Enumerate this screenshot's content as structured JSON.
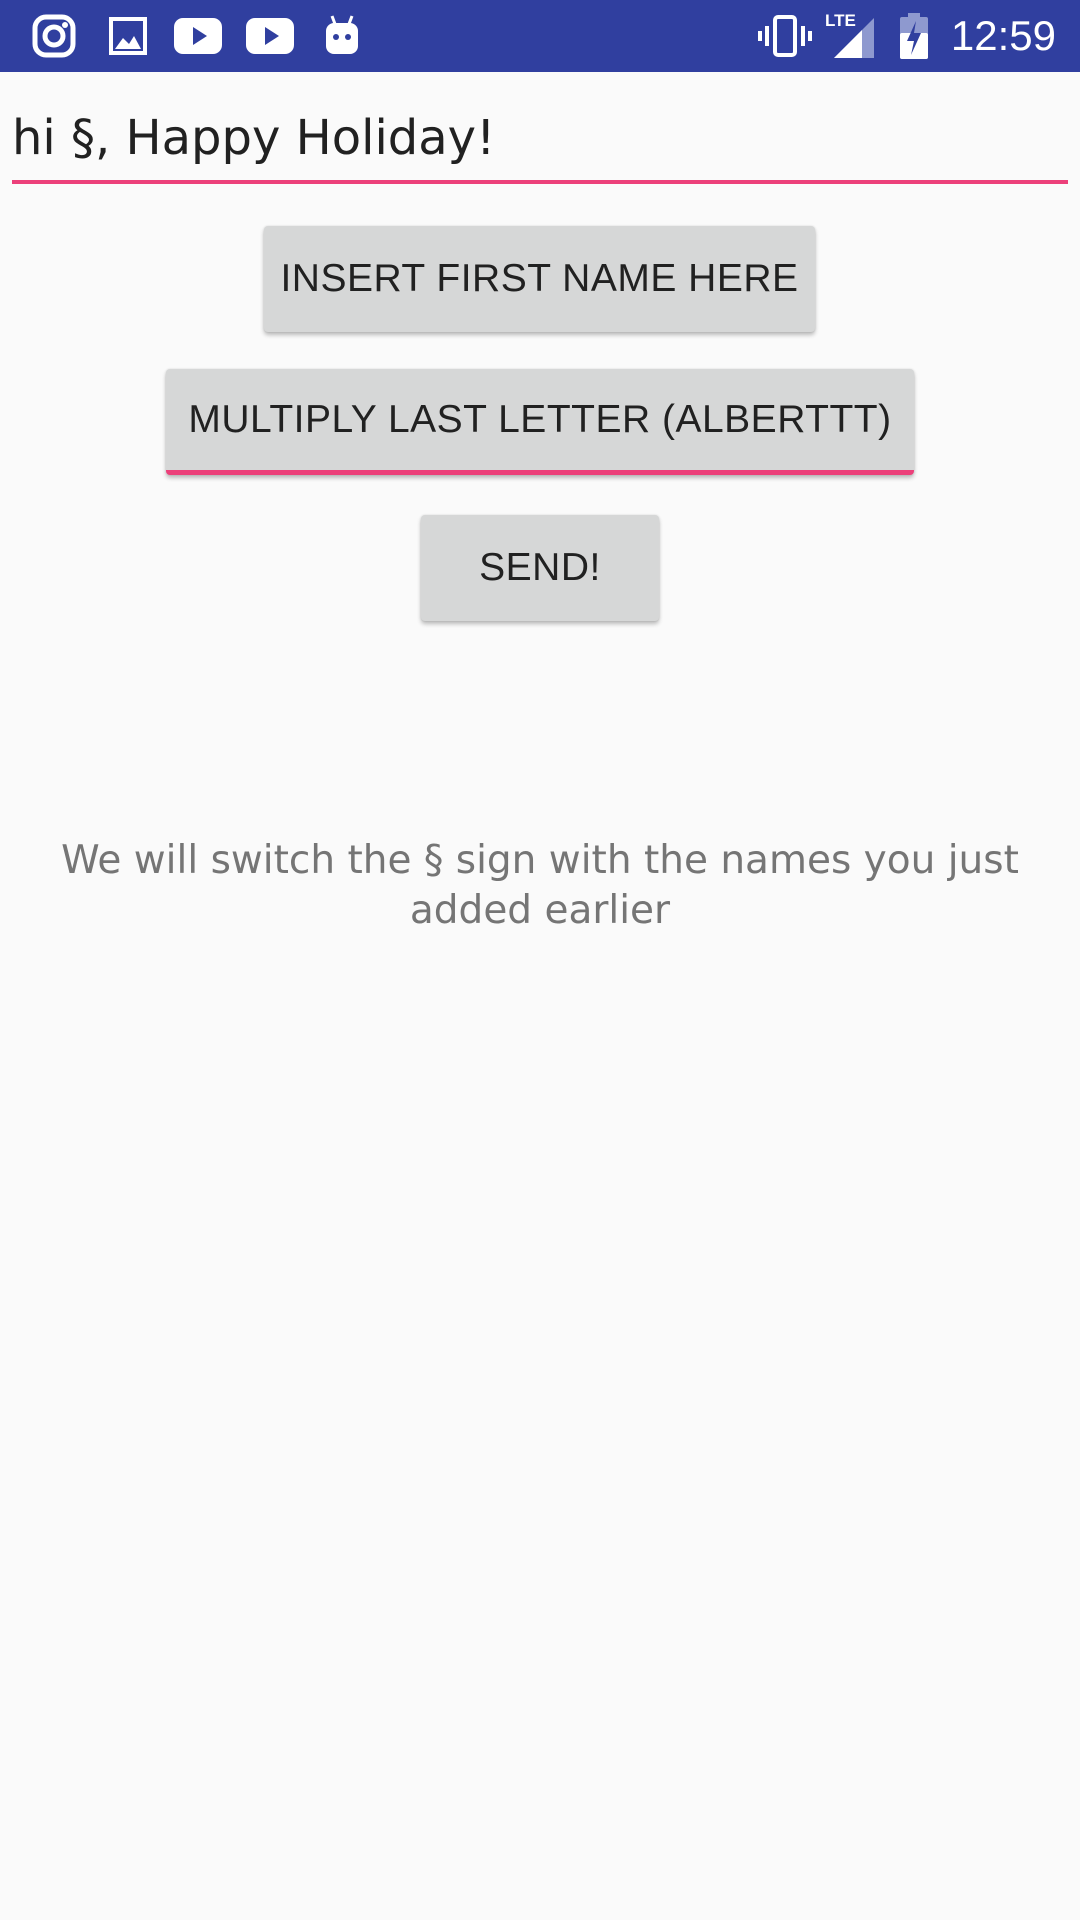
{
  "status_bar": {
    "time": "12:59",
    "network": "LTE",
    "colors": {
      "background": "#303f9f",
      "foreground": "#ffffff"
    },
    "notification_icons": [
      "instagram-icon",
      "gallery-icon",
      "youtube-icon",
      "youtube-icon",
      "android-icon"
    ],
    "system_icons": [
      "vibrate-icon",
      "lte-signal-icon",
      "battery-charging-icon"
    ]
  },
  "message_field": {
    "value": "hi §, Happy Holiday!",
    "underline_color": "#ec407a"
  },
  "buttons": {
    "insert_label": "INSERT FIRST NAME HERE",
    "multiply_label": "MULTIPLY LAST LETTER (ALBERTTT)",
    "send_label": "SEND!"
  },
  "hint_text": "We will switch the § sign with the names you just added earlier",
  "colors": {
    "background": "#fafafa",
    "accent": "#ec407a",
    "button": "#d6d7d7"
  }
}
